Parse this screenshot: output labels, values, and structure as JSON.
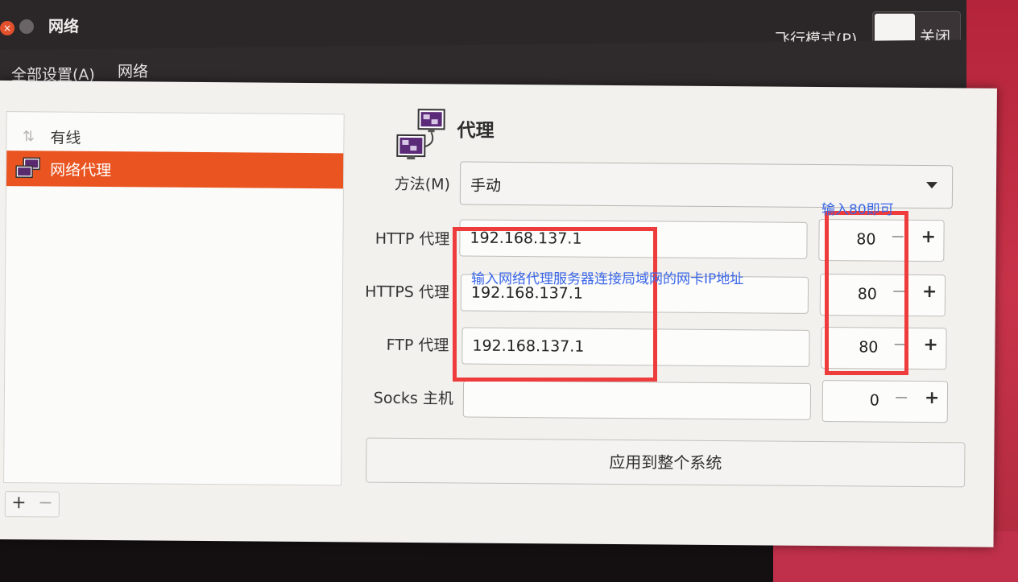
{
  "window": {
    "title": "网络",
    "close_glyph": "×"
  },
  "menubar": {
    "all_settings": "全部设置(A)",
    "network": "网络"
  },
  "airplane_mode": {
    "label": "飞行模式(P)",
    "state": "关闭"
  },
  "sidebar": {
    "items": [
      {
        "label": "有线",
        "icon": "wired-icon",
        "selected": false
      },
      {
        "label": "网络代理",
        "icon": "network-proxy-icon",
        "selected": true
      }
    ],
    "add": "+",
    "remove": "−"
  },
  "proxy": {
    "title": "代理",
    "method_label": "方法(M)",
    "method_value": "手动",
    "rows": [
      {
        "label": "HTTP 代理",
        "host": "192.168.137.1",
        "port": "80"
      },
      {
        "label": "HTTPS 代理",
        "host": "192.168.137.1",
        "port": "80"
      },
      {
        "label": "FTP 代理",
        "host": "192.168.137.1",
        "port": "80"
      },
      {
        "label": "Socks 主机",
        "host": "",
        "port": "0"
      }
    ],
    "spin_minus": "−",
    "spin_plus": "+",
    "apply_button": "应用到整个系统"
  },
  "annotations": {
    "host_note": "输入网络代理服务器连接局域网的网卡IP地址",
    "port_note": "输入80即可",
    "box_color": "#ee3b3b",
    "text_color": "#3a66e8"
  },
  "colors": {
    "accent": "#e95420",
    "titlebar": "#2b2628"
  }
}
